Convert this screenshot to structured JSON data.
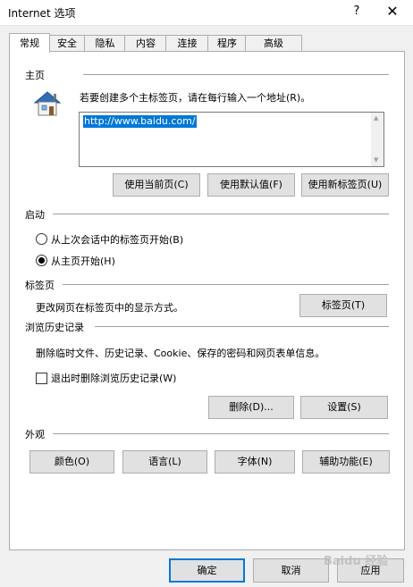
{
  "window": {
    "title": "Internet 选项",
    "help_label": "?",
    "close_label": "✕"
  },
  "tabs": [
    {
      "label": "常规"
    },
    {
      "label": "安全"
    },
    {
      "label": "隐私"
    },
    {
      "label": "内容"
    },
    {
      "label": "连接"
    },
    {
      "label": "程序"
    },
    {
      "label": "高级"
    }
  ],
  "homepage": {
    "group_label": "主页",
    "instruction": "若要创建多个主标签页，请在每行输入一个地址(R)。",
    "url": "http://www.baidu.com/",
    "btn_current": "使用当前页(C)",
    "btn_default": "使用默认值(F)",
    "btn_newtab": "使用新标签页(U)"
  },
  "startup": {
    "group_label": "启动",
    "option_last_session": "从上次会话中的标签页开始(B)",
    "option_home": "从主页开始(H)",
    "selected": "option_home"
  },
  "tabs_section": {
    "group_label": "标签页",
    "description": "更改网页在标签页中的显示方式。",
    "btn_tabs": "标签页(T)"
  },
  "history": {
    "group_label": "浏览历史记录",
    "description": "删除临时文件、历史记录、Cookie、保存的密码和网页表单信息。",
    "checkbox_delete_on_exit": "退出时删除浏览历史记录(W)",
    "btn_delete": "删除(D)...",
    "btn_settings": "设置(S)"
  },
  "appearance": {
    "group_label": "外观",
    "btn_colors": "颜色(O)",
    "btn_languages": "语言(L)",
    "btn_fonts": "字体(N)",
    "btn_accessibility": "辅助功能(E)"
  },
  "dialog": {
    "btn_ok": "确定",
    "btn_cancel": "取消",
    "btn_apply": "应用"
  },
  "watermark": "Baidu 经验",
  "colors": {
    "accent": "#0078d7",
    "panel_bg": "#ffffff",
    "window_bg": "#f0f0f0"
  }
}
